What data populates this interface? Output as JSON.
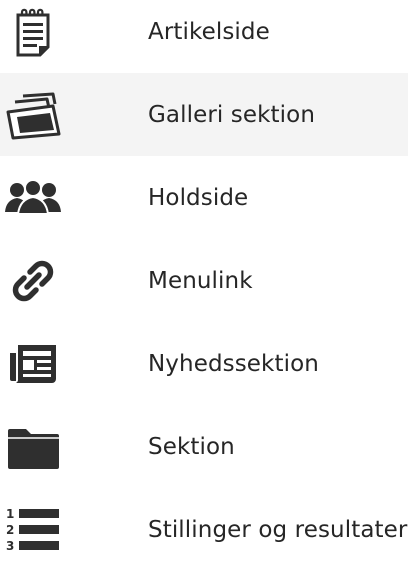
{
  "menu": {
    "items": [
      {
        "label": "Artikelside",
        "icon": "article-page-icon"
      },
      {
        "label": "Galleri sektion",
        "icon": "gallery-icon",
        "state": "hovered"
      },
      {
        "label": "Holdside",
        "icon": "team-icon"
      },
      {
        "label": "Menulink",
        "icon": "link-icon"
      },
      {
        "label": "Nyhedssektion",
        "icon": "news-icon"
      },
      {
        "label": "Sektion",
        "icon": "folder-icon"
      },
      {
        "label": "Stillinger og resultater",
        "icon": "numbered-list-icon"
      }
    ],
    "list_numbers": [
      "1",
      "2",
      "3"
    ]
  },
  "colors": {
    "icon": "#2f2f2f",
    "text": "#262626",
    "hover_background": "#f4f4f4",
    "background": "#ffffff"
  }
}
